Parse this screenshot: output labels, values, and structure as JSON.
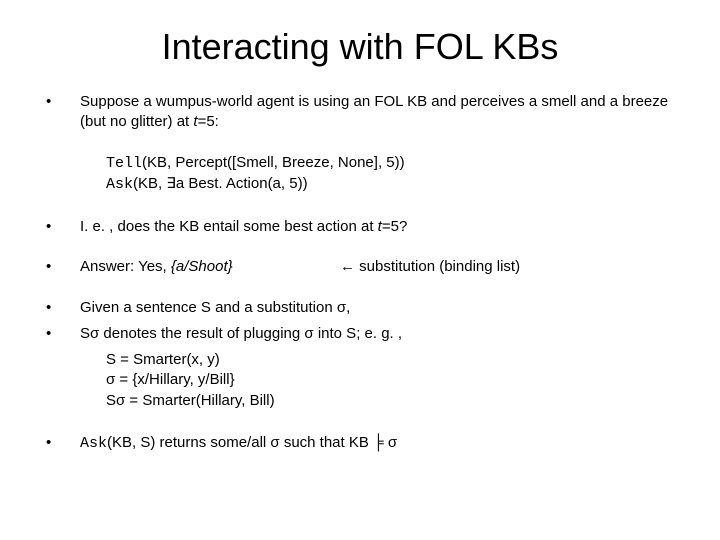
{
  "title": "Interacting with FOL KBs",
  "b1": "Suppose a wumpus-world agent is using an FOL KB and perceives a smell and a breeze (but no glitter) at ",
  "b1_t": "t",
  "b1_tail": "=5:",
  "tell_kw": "Tell",
  "tell_args": "(KB, Percept([Smell, Breeze, None], 5))",
  "ask_kw": "Ask",
  "ask_args_pre": "(KB, ",
  "ask_exists": "∃",
  "ask_args_post": "a Best. Action(a, 5))",
  "b2_pre": "I. e. , does the KB entail some best action at ",
  "b2_t": "t",
  "b2_tail": "=5?",
  "b3_left_pre": "Answer: Yes, ",
  "b3_left_sub": "{a/Shoot}",
  "b3_right": "← substitution (binding list)",
  "b4": "Given a sentence S and a substitution σ,",
  "b5": "Sσ denotes the result of plugging σ into S; e. g. ,",
  "sub1": "S = Smarter(x, y)",
  "sub2": "σ = {x/Hillary, y/Bill}",
  "sub3": "Sσ = Smarter(Hillary, Bill)",
  "b6_kw": "Ask",
  "b6_mid": "(KB, S) returns some/all σ such that KB ",
  "b6_entails": "╞",
  "b6_tail": " σ",
  "dot": "•"
}
